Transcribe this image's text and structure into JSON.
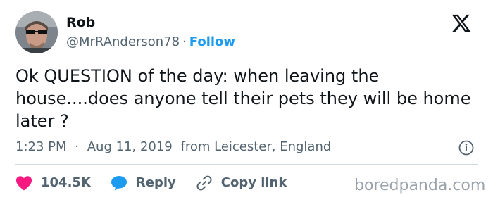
{
  "author": {
    "display_name": "Rob",
    "handle": "@MrRAnderson78",
    "separator": "·",
    "follow_label": "Follow"
  },
  "tweet": {
    "text": "Ok QUESTION of the day: when leaving the house....does anyone tell their pets they will be home later ?",
    "time": "1:23 PM",
    "separator": "·",
    "date": "Aug 11, 2019",
    "location": "from Leicester, England"
  },
  "actions": {
    "likes_count": "104.5K",
    "reply_label": "Reply",
    "copy_link_label": "Copy link"
  },
  "watermark": "boredpanda.com",
  "icons": {
    "brand": "x-logo-icon",
    "info": "info-icon",
    "like": "heart-icon",
    "reply": "reply-bubble-icon",
    "copy": "link-icon"
  },
  "colors": {
    "accent": "#1d9bf0",
    "heart": "#f91880",
    "text": "#0f1419",
    "muted": "#536471"
  }
}
